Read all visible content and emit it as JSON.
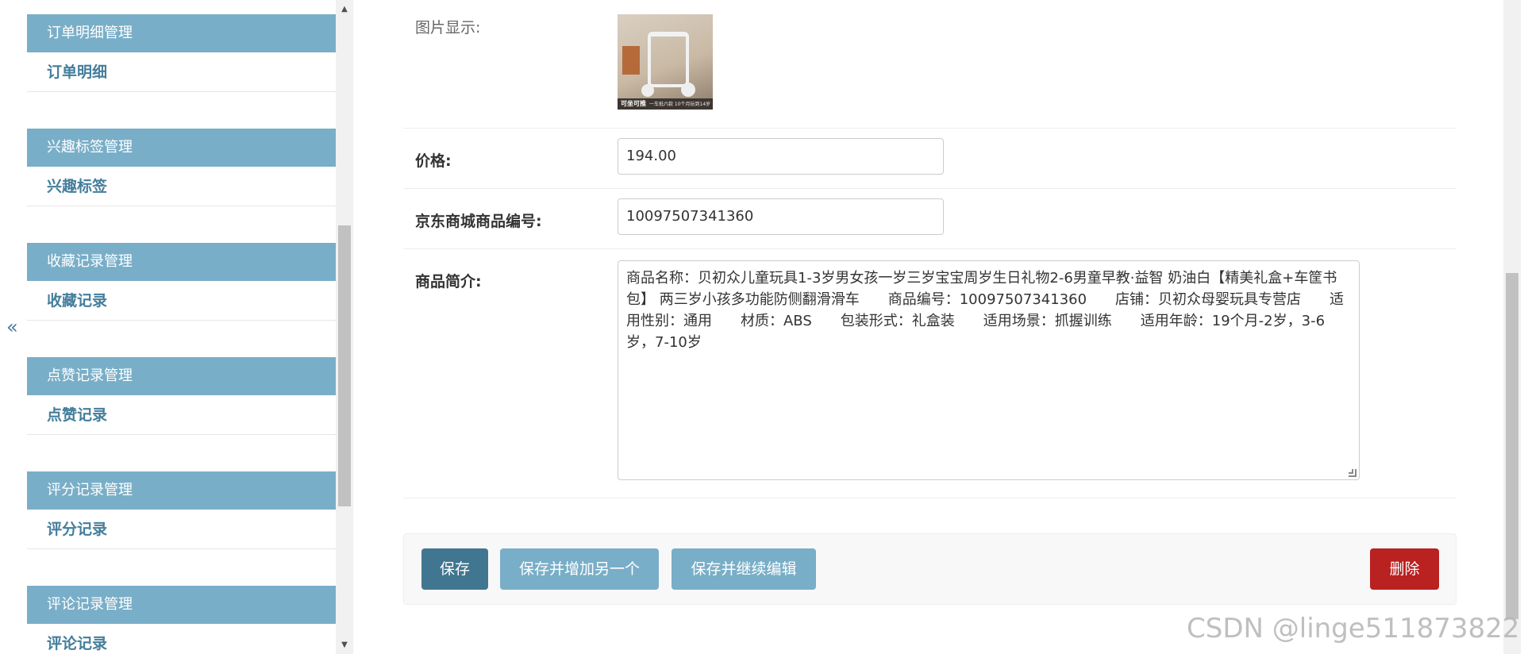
{
  "sidebar": {
    "collapse_label": "«",
    "modules": [
      {
        "caption": "订单明细管理",
        "item": "订单明细"
      },
      {
        "caption": "兴趣标签管理",
        "item": "兴趣标签"
      },
      {
        "caption": "收藏记录管理",
        "item": "收藏记录"
      },
      {
        "caption": "点赞记录管理",
        "item": "点赞记录"
      },
      {
        "caption": "评分记录管理",
        "item": "评分记录"
      },
      {
        "caption": "评论记录管理",
        "item": "评论记录"
      }
    ]
  },
  "form": {
    "image_label": "图片显示:",
    "image_caption_main": "可坐可推",
    "image_caption_sub": "一车抵六款 10个月玩到14岁",
    "price_label": "价格:",
    "price_value": "194.00",
    "sku_label": "京东商城商品编号:",
    "sku_value": "10097507341360",
    "desc_label": "商品简介:",
    "desc_value": "商品名称：贝初众儿童玩具1-3岁男女孩一岁三岁宝宝周岁生日礼物2-6男童早教·益智 奶油白【精美礼盒+车筐书包】 两三岁小孩多功能防侧翻滑滑车　　商品编号：10097507341360　　店铺：贝初众母婴玩具专营店　　适用性别：通用　　材质：ABS　　包装形式：礼盒装　　适用场景：抓握训练　　适用年龄：19个月-2岁，3-6岁，7-10岁"
  },
  "actions": {
    "save": "保存",
    "save_add": "保存并增加另一个",
    "save_continue": "保存并继续编辑",
    "delete": "删除"
  },
  "watermark": "CSDN @linge511873822",
  "colors": {
    "module_caption": "#79aec8",
    "module_item_text": "#447e9b",
    "save_button": "#417690",
    "secondary_button": "#79aec8",
    "delete_button": "#ba2121"
  },
  "icons": {
    "collapse": "double-chevron-left-icon",
    "scroll_up": "triangle-up-icon",
    "scroll_down": "triangle-down-icon"
  }
}
